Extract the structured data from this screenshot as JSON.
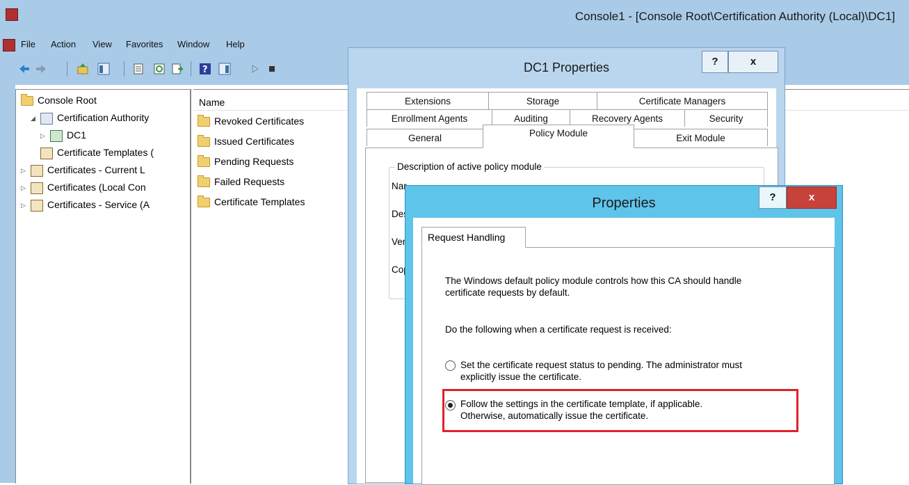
{
  "mmc": {
    "title": "Console1 - [Console Root\\Certification Authority (Local)\\DC1]",
    "menu": [
      "File",
      "Action",
      "View",
      "Favorites",
      "Window",
      "Help"
    ],
    "toolbar_icons": [
      "back-arrow-icon",
      "forward-arrow-icon",
      "up-folder-icon",
      "show-hide-tree-icon",
      "properties-icon",
      "refresh-icon",
      "export-list-icon",
      "help-icon",
      "show-hide-action-pane-icon",
      "start-service-icon",
      "stop-service-icon"
    ]
  },
  "scope_tree": [
    {
      "label": "Console Root",
      "icon": "folder-icon"
    },
    {
      "label": "Certification Authority",
      "icon": "ca-icon",
      "expander": "◢"
    },
    {
      "label": "DC1",
      "icon": "ca-server-icon",
      "expander": "▷"
    },
    {
      "label": "Certificate Templates (",
      "icon": "templates-icon"
    },
    {
      "label": "Certificates - Current L",
      "icon": "certificates-icon",
      "expander": "▷"
    },
    {
      "label": "Certificates (Local Con",
      "icon": "certificates-icon",
      "expander": "▷"
    },
    {
      "label": "Certificates - Service (A",
      "icon": "certificates-icon",
      "expander": "▷"
    }
  ],
  "results": {
    "column_header": "Name",
    "items": [
      "Revoked Certificates",
      "Issued Certificates",
      "Pending Requests",
      "Failed Requests",
      "Certificate Templates"
    ]
  },
  "dc1_dialog": {
    "title": "DC1 Properties",
    "help_label": "?",
    "close_label": "x",
    "tabs_row1": [
      "Extensions",
      "Storage",
      "Certificate Managers"
    ],
    "tabs_row2": [
      "Enrollment Agents",
      "Auditing",
      "Recovery Agents",
      "Security"
    ],
    "tabs_row3": [
      "General",
      "Policy Module",
      "Exit Module"
    ],
    "group_label": "Description of active policy module",
    "fields": [
      "Nar",
      "Des",
      "Ver",
      "Cop"
    ]
  },
  "prop_dialog": {
    "title": "Properties",
    "help_label": "?",
    "close_label": "x",
    "tab": "Request Handling",
    "intro_line1": "The Windows default policy module controls how this CA should handle",
    "intro_line2": "certificate requests by default.",
    "prompt": "Do the following when a certificate request is received:",
    "option1_line1": "Set the certificate request status to pending. The administrator must",
    "option1_line2": "explicitly issue the certificate.",
    "option2_line1": "Follow the settings in the certificate template, if applicable.",
    "option2_line2": "Otherwise, automatically issue the certificate.",
    "selected_option": 2,
    "highlight_color": "#e0202a"
  }
}
